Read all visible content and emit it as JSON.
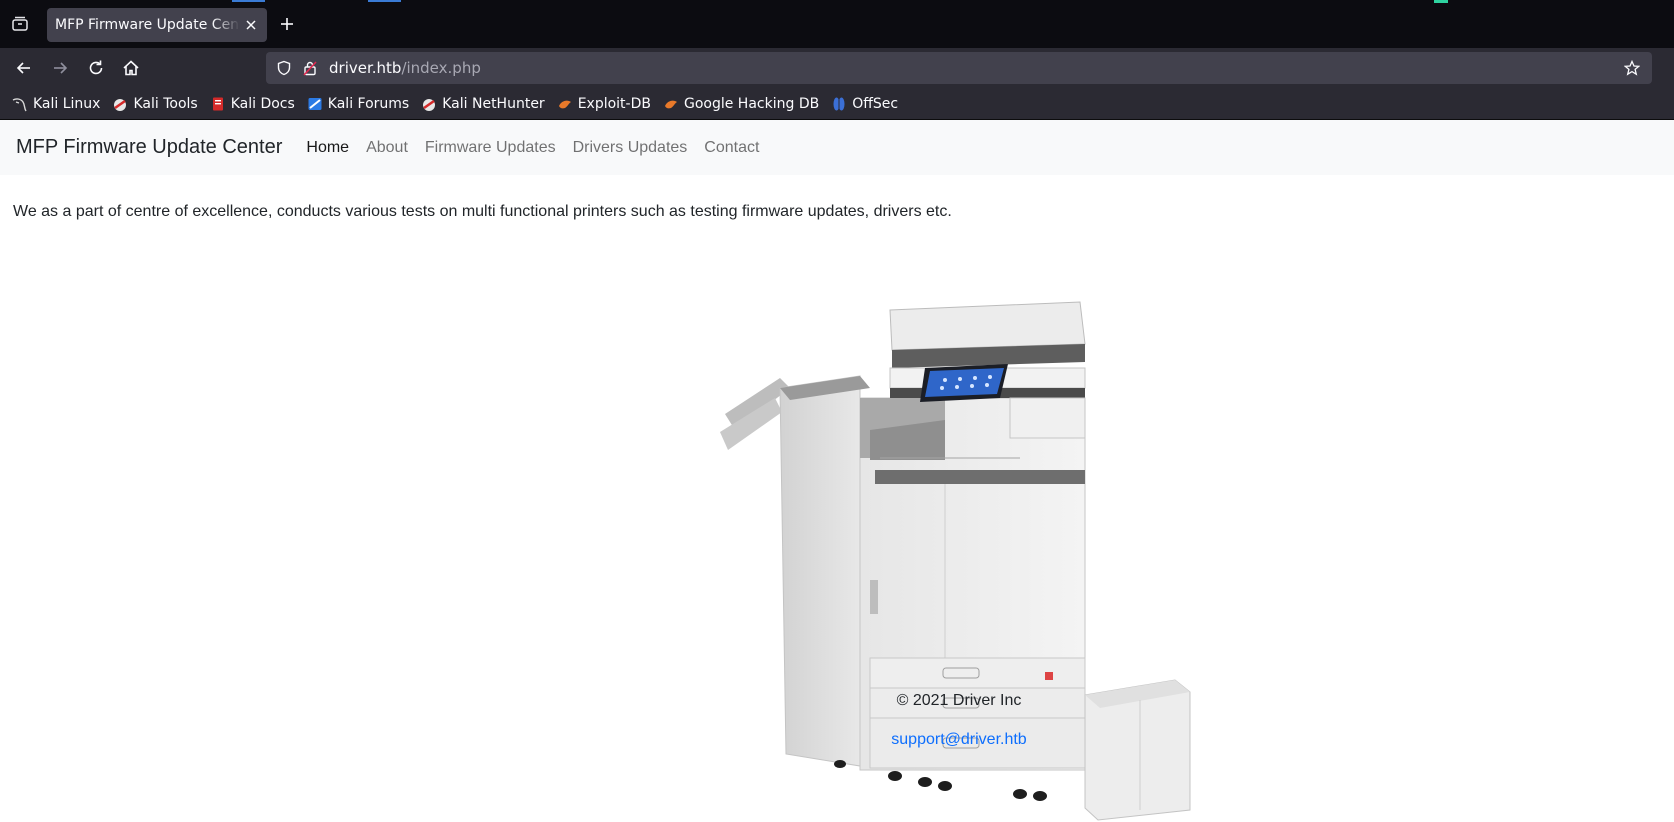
{
  "browser": {
    "tab": {
      "title": "MFP Firmware Update Center"
    },
    "url": {
      "host": "driver.htb",
      "path": "/index.php"
    },
    "bookmarks": [
      {
        "label": "Kali Linux",
        "icon": "kali-dragon-icon"
      },
      {
        "label": "Kali Tools",
        "icon": "kali-tools-icon"
      },
      {
        "label": "Kali Docs",
        "icon": "kali-docs-icon"
      },
      {
        "label": "Kali Forums",
        "icon": "kali-forums-icon"
      },
      {
        "label": "Kali NetHunter",
        "icon": "kali-nethunter-icon"
      },
      {
        "label": "Exploit-DB",
        "icon": "exploit-db-icon"
      },
      {
        "label": "Google Hacking DB",
        "icon": "ghdb-icon"
      },
      {
        "label": "OffSec",
        "icon": "offsec-icon"
      }
    ]
  },
  "site": {
    "brand": "MFP Firmware Update Center",
    "nav": [
      {
        "label": "Home",
        "active": true
      },
      {
        "label": "About",
        "active": false
      },
      {
        "label": "Firmware Updates",
        "active": false
      },
      {
        "label": "Drivers Updates",
        "active": false
      },
      {
        "label": "Contact",
        "active": false
      }
    ],
    "intro": "We as a part of centre of excellence, conducts various tests on multi functional printers such as testing firmware updates, drivers etc.",
    "footer": {
      "copyright": "© 2021 Driver Inc",
      "email": "support@driver.htb"
    }
  },
  "colors": {
    "chrome_dark": "#0c0c11",
    "toolbar": "#2b2a33",
    "urlbar": "#42414d",
    "navbar_bg": "#f8f9fa",
    "link": "#0d6efd"
  }
}
